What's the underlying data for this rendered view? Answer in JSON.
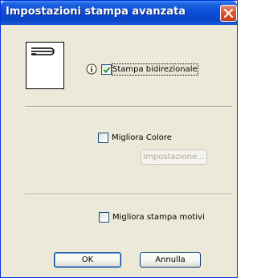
{
  "window": {
    "title": "Impostazioni stampa avanzata"
  },
  "options": {
    "bidirectional": {
      "label": "Stampa bidirezionale",
      "checked": true
    },
    "improve_color": {
      "label": "Migliora Colore",
      "checked": false,
      "settings_label": "Impostazione..."
    },
    "improve_pattern": {
      "label": "Migliora stampa motivi",
      "checked": false
    }
  },
  "buttons": {
    "ok": "OK",
    "cancel": "Annulla"
  },
  "icons": {
    "close": "close-icon",
    "info": "info-icon",
    "preview": "print-direction-icon"
  },
  "colors": {
    "titlebar": "#0a47c9",
    "dialog_bg": "#ece9d8",
    "close": "#d8572f",
    "checkmark": "#21a121"
  }
}
